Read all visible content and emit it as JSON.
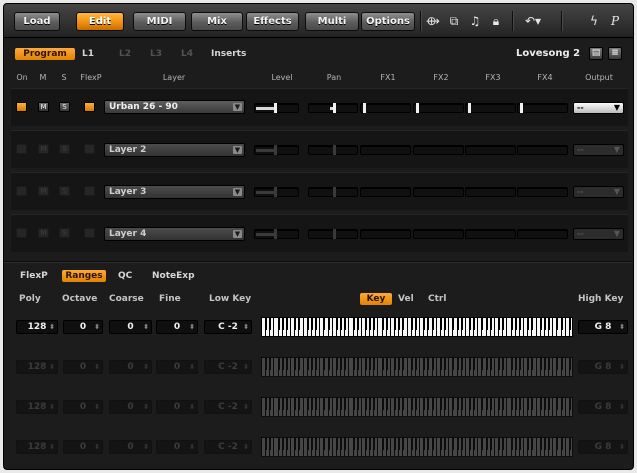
{
  "toolbar": {
    "buttons": [
      "Load",
      "Edit",
      "MIDI",
      "Mix",
      "Effects",
      "Multi",
      "Options"
    ],
    "active": "Edit",
    "right_label": "P"
  },
  "program": {
    "tabs": [
      "Program",
      "L1",
      "L2",
      "L3",
      "L4",
      "Inserts"
    ],
    "name": "Lovesong 2"
  },
  "layer_columns": [
    "On",
    "M",
    "S",
    "FlexP",
    "Layer",
    "Level",
    "Pan",
    "FX1",
    "FX2",
    "FX3",
    "FX4",
    "Output"
  ],
  "layers": [
    {
      "name": "Urban 26 - 90",
      "on": true,
      "level": 0.5,
      "pan": 0.5,
      "output": "--"
    },
    {
      "name": "Layer 2",
      "on": false,
      "level": 0.5,
      "pan": 0.5,
      "output": "--"
    },
    {
      "name": "Layer 3",
      "on": false,
      "level": 0.5,
      "pan": 0.5,
      "output": "--"
    },
    {
      "name": "Layer 4",
      "on": false,
      "level": 0.5,
      "pan": 0.5,
      "output": "--"
    }
  ],
  "bottom_tabs": [
    "FlexP",
    "Ranges",
    "QC",
    "NoteExp"
  ],
  "bottom_active": "Ranges",
  "range_columns": [
    "Poly",
    "Octave",
    "Coarse",
    "Fine",
    "Low Key",
    "High Key"
  ],
  "key_modes": [
    "Key",
    "Vel",
    "Ctrl"
  ],
  "key_mode_active": "Key",
  "ranges": [
    {
      "poly": "128",
      "octave": "0",
      "coarse": "0",
      "fine": "0",
      "low": "C -2",
      "high": "G 8",
      "active": true
    },
    {
      "poly": "128",
      "octave": "0",
      "coarse": "0",
      "fine": "0",
      "low": "C -2",
      "high": "G 8",
      "active": false
    },
    {
      "poly": "128",
      "octave": "0",
      "coarse": "0",
      "fine": "0",
      "low": "C -2",
      "high": "G 8",
      "active": false
    },
    {
      "poly": "128",
      "octave": "0",
      "coarse": "0",
      "fine": "0",
      "low": "C -2",
      "high": "G 8",
      "active": false
    }
  ]
}
